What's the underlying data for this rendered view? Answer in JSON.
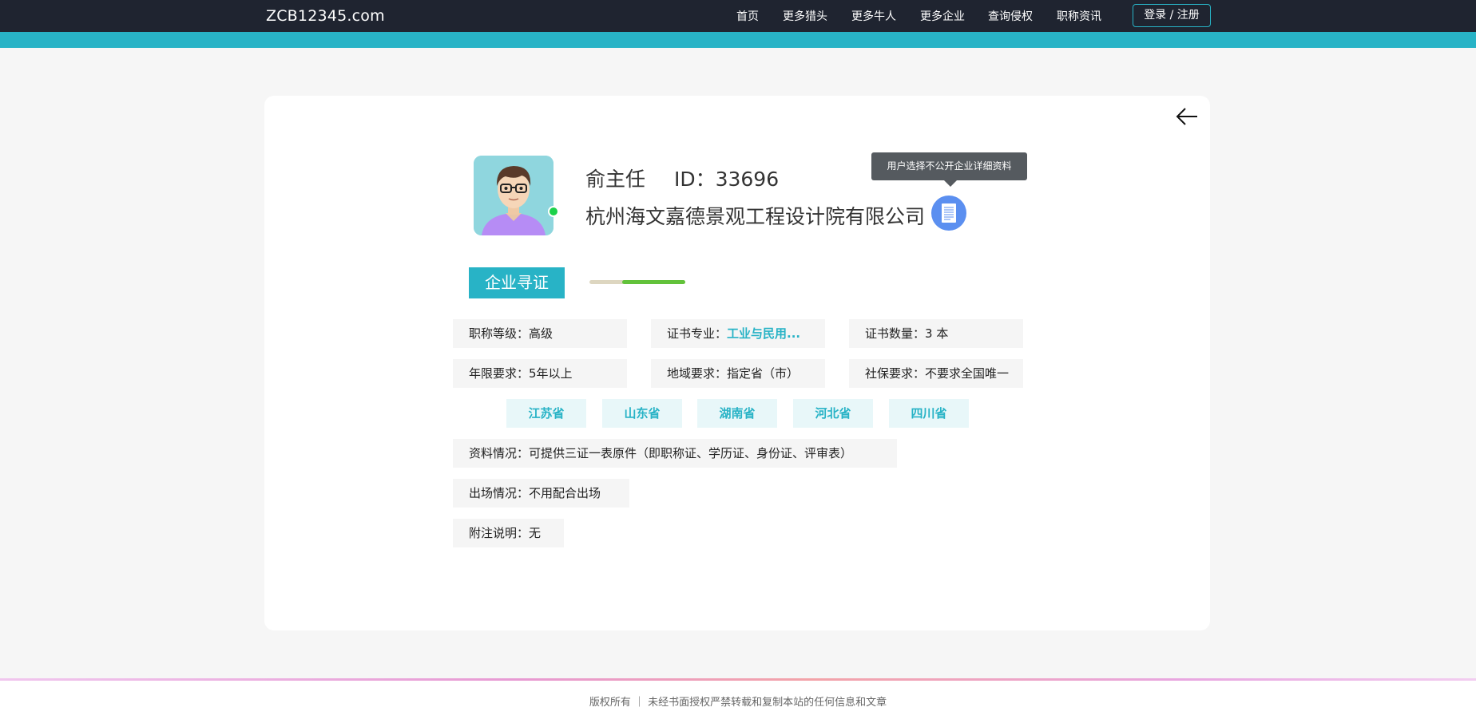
{
  "nav": {
    "logo": "ZCB12345.com",
    "items": [
      "首页",
      "更多猎头",
      "更多牛人",
      "更多企业",
      "查询侵权",
      "职称资讯"
    ],
    "login": "登录 / 注册"
  },
  "profile": {
    "name": "俞主任",
    "id_label": "ID：33696",
    "company": "杭州海文嘉德景观工程设计院有限公司",
    "tooltip": "用户选择不公开企业详细资料",
    "online": true
  },
  "tag": "企业寻证",
  "progress": 0.66,
  "fields": {
    "title_level": {
      "label": "职称等级：",
      "value": "高级"
    },
    "cert_major": {
      "label": "证书专业：",
      "value": "工业与民用..."
    },
    "cert_count": {
      "label": "证书数量：",
      "value": "3 本"
    },
    "years": {
      "label": "年限要求：",
      "value": "5年以上"
    },
    "region": {
      "label": "地域要求：",
      "value": "指定省（市）"
    },
    "social": {
      "label": "社保要求：",
      "value": "不要求全国唯一"
    },
    "docs": {
      "label": "资料情况：",
      "value": "可提供三证一表原件（即职称证、学历证、身份证、评审表）"
    },
    "attendance": {
      "label": "出场情况：",
      "value": "不用配合出场"
    },
    "notes": {
      "label": "附注说明：",
      "value": "无"
    }
  },
  "provinces": [
    "江苏省",
    "山东省",
    "湖南省",
    "河北省",
    "四川省"
  ],
  "footer": "版权所有 ｜ 未经书面授权严禁转载和复制本站的任何信息和文章",
  "colors": {
    "accent": "#28b3c6",
    "nav_bg": "#1f2430",
    "online": "#1bd14a",
    "progress_fill": "#62c23a"
  },
  "icons": {
    "back": "arrow-left-icon",
    "doc": "document-icon",
    "avatar": "avatar-illustration"
  }
}
